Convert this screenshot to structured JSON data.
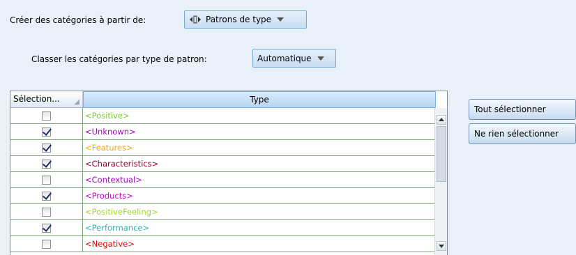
{
  "create_from": {
    "label": "Créer des catégories à partir de:",
    "value": "Patrons de type",
    "icon": "pattern-icon"
  },
  "sort_by": {
    "label": "Classer les catégories par type de patron:",
    "value": "Automatique"
  },
  "table": {
    "columns": [
      "Sélection...",
      "Type"
    ],
    "rows": [
      {
        "type": "<Positive>",
        "checked": false,
        "color": "#7ac832"
      },
      {
        "type": "<Unknown>",
        "checked": true,
        "color": "#a800c8"
      },
      {
        "type": "<Features>",
        "checked": true,
        "color": "#f0a800"
      },
      {
        "type": "<Characteristics>",
        "checked": true,
        "color": "#990033"
      },
      {
        "type": "<Contextual>",
        "checked": false,
        "color": "#a800c8"
      },
      {
        "type": "<Products>",
        "checked": true,
        "color": "#c800c8"
      },
      {
        "type": "<PositiveFeeling>",
        "checked": false,
        "color": "#a6d629"
      },
      {
        "type": "<Performance>",
        "checked": true,
        "color": "#1fb5b5"
      },
      {
        "type": "<Negative>",
        "checked": false,
        "color": "#e80000"
      }
    ]
  },
  "buttons": {
    "select_all": "Tout sélectionner",
    "select_none": "Ne rien sélectionner"
  }
}
